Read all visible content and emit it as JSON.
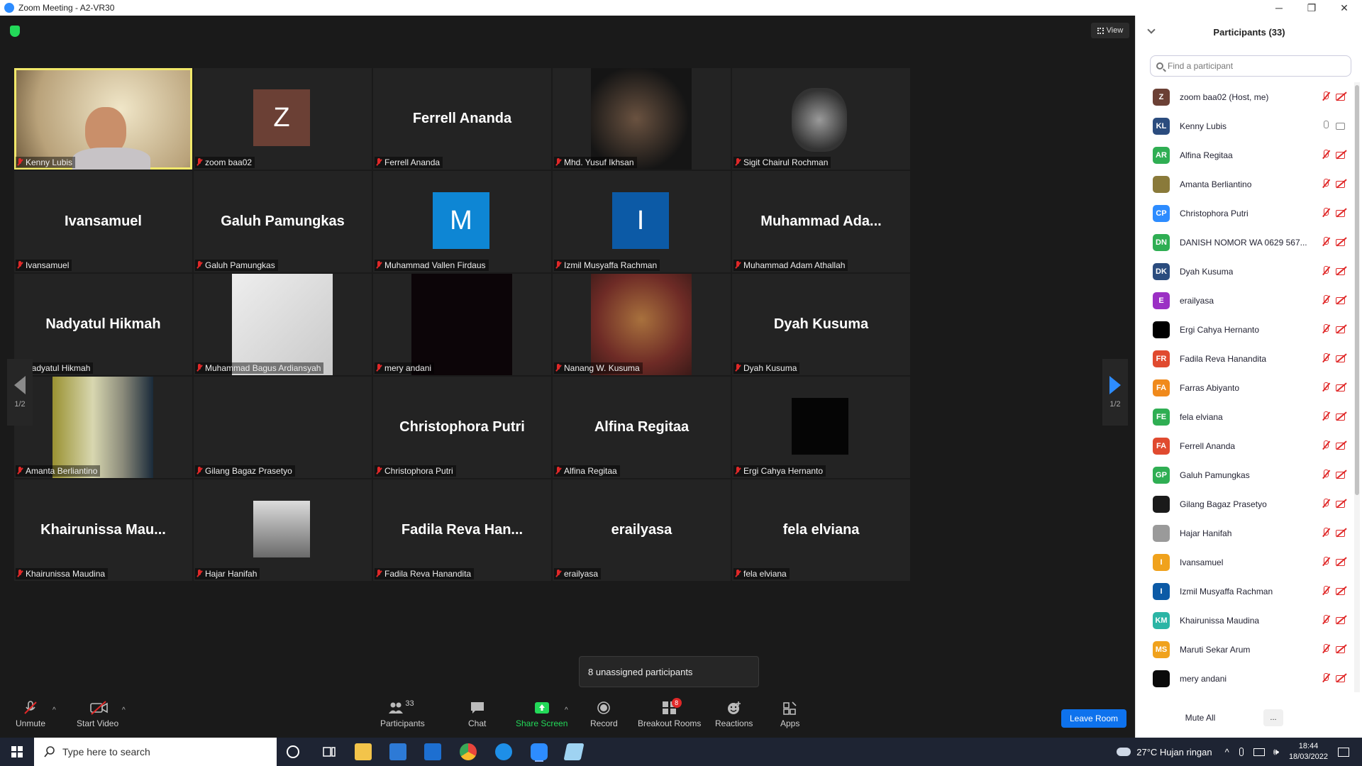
{
  "window": {
    "title": "Zoom Meeting - A2-VR30",
    "minimize": "─",
    "maximize": "❐",
    "close": "✕"
  },
  "view_button": "View",
  "pager": {
    "left_page": "1/2",
    "right_page": "1/2"
  },
  "tiles": [
    {
      "label": "Kenny Lubis",
      "kind": "video",
      "active": true
    },
    {
      "label": "zoom baa02",
      "kind": "avatar",
      "initial": "Z",
      "avatar_color": "#6b4035"
    },
    {
      "label": "Ferrell Ananda",
      "kind": "name",
      "big_name": "Ferrell Ananda"
    },
    {
      "label": "Mhd. Yusuf Ikhsan",
      "kind": "photo-dark"
    },
    {
      "label": "Sigit Chairul Rochman",
      "kind": "emblem"
    },
    {
      "label": "Ivansamuel",
      "kind": "name",
      "big_name": "Ivansamuel"
    },
    {
      "label": "Galuh Pamungkas",
      "kind": "name",
      "big_name": "Galuh Pamungkas"
    },
    {
      "label": "Muhammad Vallen Firdaus",
      "kind": "avatar",
      "initial": "M",
      "avatar_color": "#0e86d4"
    },
    {
      "label": "Izmil Musyaffa Rachman",
      "kind": "avatar",
      "initial": "I",
      "avatar_color": "#0c5aa6"
    },
    {
      "label": "Muhammad Adam Athallah",
      "kind": "name",
      "big_name": "Muhammad  Ada..."
    },
    {
      "label": "Nadyatul Hikmah",
      "kind": "name",
      "big_name": "Nadyatul Hikmah"
    },
    {
      "label": "Muhammad Bagus Ardiansyah",
      "kind": "photo-light"
    },
    {
      "label": "mery andani",
      "kind": "photo-black"
    },
    {
      "label": "Nanang W. Kusuma",
      "kind": "photo-face"
    },
    {
      "label": "Dyah Kusuma",
      "kind": "name",
      "big_name": "Dyah Kusuma"
    },
    {
      "label": "Amanta Berliantino",
      "kind": "photo-shirt"
    },
    {
      "label": "Gilang Bagaz Prasetyo",
      "kind": "blank"
    },
    {
      "label": "Christophora Putri",
      "kind": "name",
      "big_name": "Christophora Putri"
    },
    {
      "label": "Alfina Regitaa",
      "kind": "name",
      "big_name": "Alfina Regitaa"
    },
    {
      "label": "Ergi Cahya Hernanto",
      "kind": "avatar-black"
    },
    {
      "label": "Khairunissa Maudina",
      "kind": "name",
      "big_name": "Khairunissa  Mau..."
    },
    {
      "label": "Hajar Hanifah",
      "kind": "avatar-photo"
    },
    {
      "label": "Fadila Reva Hanandita",
      "kind": "name",
      "big_name": "Fadila  Reva  Han..."
    },
    {
      "label": "erailyasa",
      "kind": "name",
      "big_name": "erailyasa"
    },
    {
      "label": "fela elviana",
      "kind": "name",
      "big_name": "fela elviana"
    }
  ],
  "unassigned_popup": "8 unassigned participants",
  "toolbar": {
    "unmute": "Unmute",
    "start_video": "Start Video",
    "participants": "Participants",
    "participants_count": "33",
    "chat": "Chat",
    "share_screen": "Share Screen",
    "record": "Record",
    "breakout_rooms": "Breakout Rooms",
    "breakout_badge": "8",
    "reactions": "Reactions",
    "apps": "Apps",
    "leave_room": "Leave Room"
  },
  "panel": {
    "title": "Participants (33)",
    "search_placeholder": "Find a participant",
    "mute_all": "Mute All",
    "more": "...",
    "participants": [
      {
        "initials": "Z",
        "name": "zoom baa02 (Host, me)",
        "color": "#6b4035",
        "mic": "muted",
        "cam": "off"
      },
      {
        "initials": "KL",
        "name": "Kenny Lubis",
        "color": "#2b4c7e",
        "mic": "on",
        "cam": "on"
      },
      {
        "initials": "AR",
        "name": "Alfina Regitaa",
        "color": "#2fae53",
        "mic": "muted",
        "cam": "off"
      },
      {
        "initials": "",
        "name": "Amanta Berliantino",
        "color": "#8a7a3a",
        "mic": "muted",
        "cam": "off"
      },
      {
        "initials": "CP",
        "name": "Christophora Putri",
        "color": "#2d8cff",
        "mic": "muted",
        "cam": "off"
      },
      {
        "initials": "DN",
        "name": "DANISH NOMOR WA 0629 567...",
        "color": "#2fae53",
        "mic": "muted",
        "cam": "off"
      },
      {
        "initials": "DK",
        "name": "Dyah Kusuma",
        "color": "#2b4c7e",
        "mic": "muted",
        "cam": "off"
      },
      {
        "initials": "E",
        "name": "erailyasa",
        "color": "#9b30c4",
        "mic": "muted",
        "cam": "off"
      },
      {
        "initials": "",
        "name": "Ergi Cahya Hernanto",
        "color": "#000000",
        "mic": "muted",
        "cam": "off"
      },
      {
        "initials": "FR",
        "name": "Fadila Reva Hanandita",
        "color": "#e04a2f",
        "mic": "muted",
        "cam": "off"
      },
      {
        "initials": "FA",
        "name": "Farras Abiyanto",
        "color": "#f08a1c",
        "mic": "muted",
        "cam": "off"
      },
      {
        "initials": "FE",
        "name": "fela elviana",
        "color": "#2fae53",
        "mic": "muted",
        "cam": "off"
      },
      {
        "initials": "FA",
        "name": "Ferrell Ananda",
        "color": "#e04a2f",
        "mic": "muted",
        "cam": "off"
      },
      {
        "initials": "GP",
        "name": "Galuh Pamungkas",
        "color": "#2fae53",
        "mic": "muted",
        "cam": "off"
      },
      {
        "initials": "",
        "name": "Gilang Bagaz Prasetyo",
        "color": "#1a1a1a",
        "mic": "muted",
        "cam": "off"
      },
      {
        "initials": "",
        "name": "Hajar Hanifah",
        "color": "#9a9a9a",
        "mic": "muted",
        "cam": "off"
      },
      {
        "initials": "I",
        "name": "Ivansamuel",
        "color": "#f0a21c",
        "mic": "muted",
        "cam": "off"
      },
      {
        "initials": "I",
        "name": "Izmil Musyaffa Rachman",
        "color": "#0c5aa6",
        "mic": "muted",
        "cam": "off"
      },
      {
        "initials": "KM",
        "name": "Khairunissa Maudina",
        "color": "#2bb5a5",
        "mic": "muted",
        "cam": "off"
      },
      {
        "initials": "MS",
        "name": "Maruti Sekar Arum",
        "color": "#f0a21c",
        "mic": "muted",
        "cam": "off"
      },
      {
        "initials": "",
        "name": "mery andani",
        "color": "#0a0a0a",
        "mic": "muted",
        "cam": "off"
      }
    ]
  },
  "taskbar": {
    "search_placeholder": "Type here to search",
    "weather": "27°C  Hujan ringan",
    "time": "18:44",
    "date": "18/03/2022"
  }
}
